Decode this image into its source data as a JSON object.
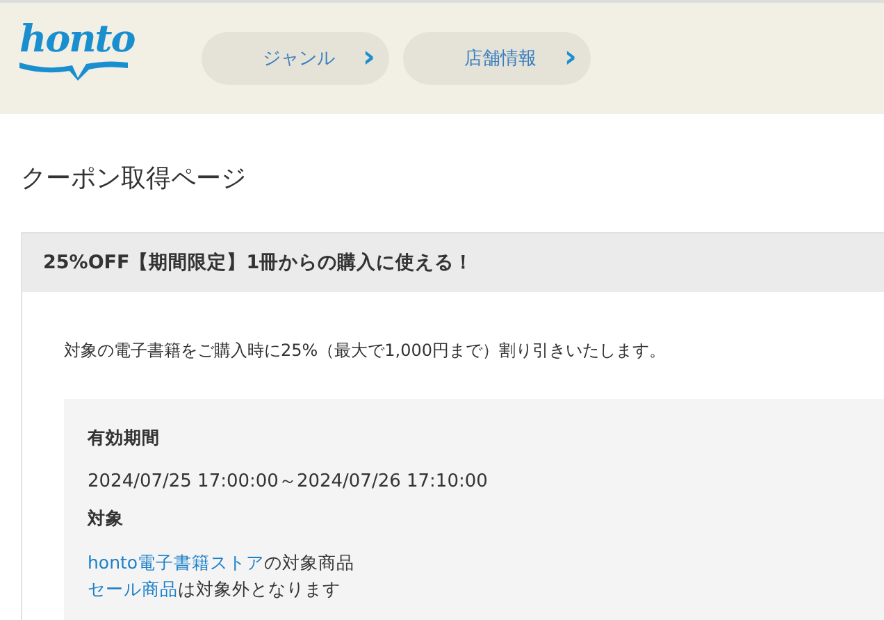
{
  "header": {
    "logo": "honto",
    "nav": [
      {
        "label": "ジャンル",
        "icon": "›"
      },
      {
        "label": "店舗情報",
        "icon": "›"
      }
    ]
  },
  "page_title": "クーポン取得ページ",
  "coupon": {
    "title": "25%OFF【期間限定】1冊からの購入に使える！",
    "description": "対象の電子書籍をご購入時に25%（最大で1,000円まで）割り引きいたします。",
    "details": [
      {
        "kind": "text",
        "heading": "有効期間",
        "lines": [
          {
            "text": "2024/07/25 17:00:00～2024/07/26 17:10:00"
          }
        ]
      },
      {
        "kind": "links",
        "heading": "対象",
        "lines": [
          {
            "link": "honto電子書籍ストア",
            "text": "の対象商品"
          },
          {
            "link": "セール商品",
            "text": "は対象外となります"
          }
        ]
      }
    ]
  }
}
